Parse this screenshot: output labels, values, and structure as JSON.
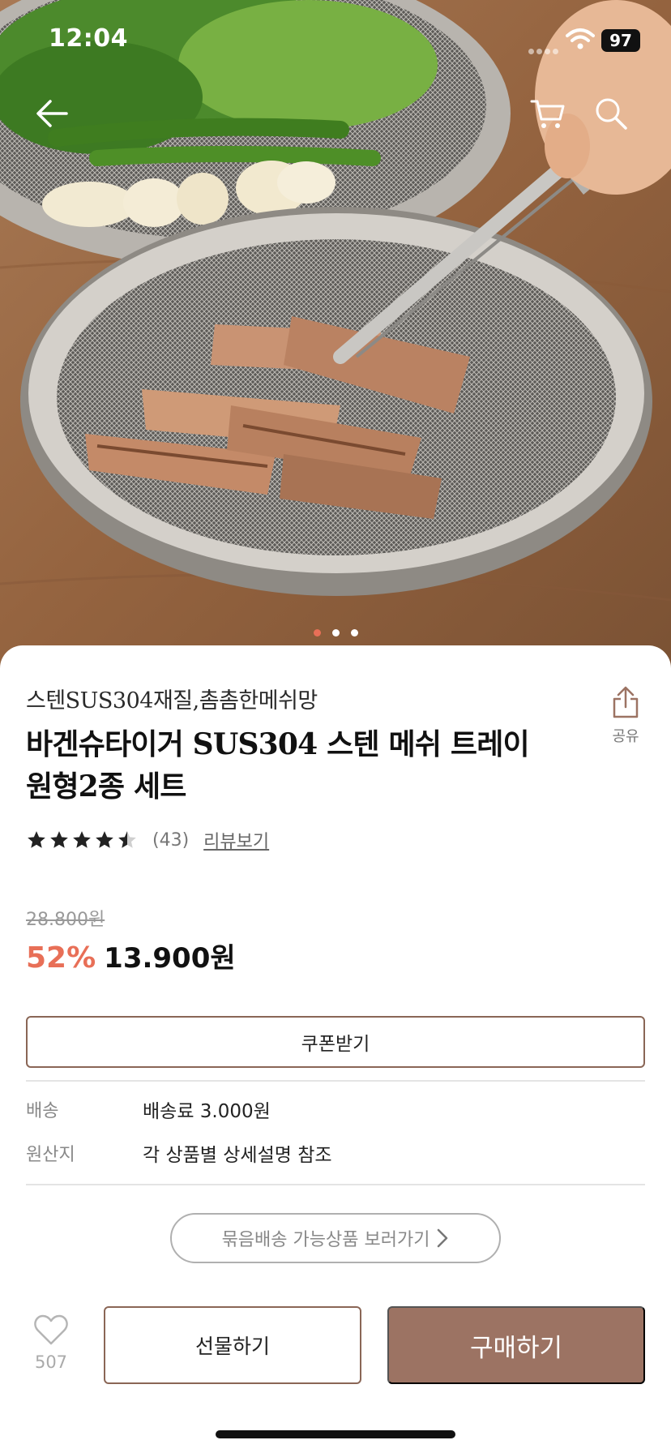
{
  "status": {
    "time": "12:04",
    "battery": "97"
  },
  "nav": {
    "back_icon": "arrow-left-icon",
    "cart_icon": "cart-icon",
    "search_icon": "search-icon"
  },
  "carousel": {
    "count": 3,
    "active_index": 0
  },
  "product": {
    "subtitle": "스텐SUS304재질,촘촘한메쉬망",
    "title": "바겐슈타이거 SUS304 스텐 메쉬 트레이 원형2종 세트",
    "rating": 4.5,
    "review_count": "(43)",
    "review_link": "리뷰보기",
    "share_label": "공유",
    "original_price": "28.800원",
    "discount": "52%",
    "price": "13.900원"
  },
  "coupon": {
    "label": "쿠폰받기"
  },
  "info": [
    {
      "key": "배송",
      "value": "배송료 3.000원"
    },
    {
      "key": "원산지",
      "value": "각 상품별 상세설명 참조"
    }
  ],
  "bundle": {
    "label": "묶음배송 가능상품 보러가기"
  },
  "bottom_bar": {
    "likes": "507",
    "gift_label": "선물하기",
    "buy_label": "구매하기"
  },
  "colors": {
    "accent": "#e86f57",
    "brand": "#9c7363",
    "border": "#8a6656"
  }
}
